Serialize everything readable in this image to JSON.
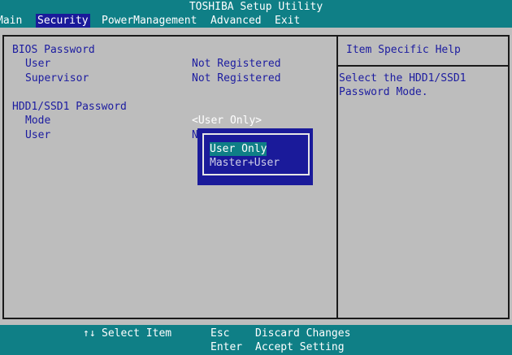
{
  "title": "TOSHIBA Setup Utility",
  "menu": {
    "main": "Main",
    "security": "Security",
    "power": "PowerManagement",
    "advanced": "Advanced",
    "exit": "Exit"
  },
  "bios_password": {
    "heading": "BIOS Password",
    "user_label": "User",
    "user_value": "Not Registered",
    "supervisor_label": "Supervisor",
    "supervisor_value": "Not Registered"
  },
  "hdd_password": {
    "heading": "HDD1/SSD1 Password",
    "mode_label": "Mode",
    "mode_value": "<User Only>",
    "user_label": "User",
    "user_value_partial": "N"
  },
  "help": {
    "title": "Item Specific Help",
    "line1": "Select the HDD1/SSD1",
    "line2": "Password Mode."
  },
  "popup": {
    "options": [
      "User Only",
      "Master+User"
    ],
    "selected": "User Only"
  },
  "status": {
    "arrows_icon": "↑↓",
    "select_item": "Select Item",
    "esc_key": "Esc",
    "esc_action": "Discard Changes",
    "enter_key": "Enter",
    "enter_action": "Accept Setting"
  },
  "colors": {
    "teal": "#0f7f86",
    "navy": "#1a1a9a",
    "panel_bg": "#bdbdbd",
    "text": "#1c1ca0"
  }
}
